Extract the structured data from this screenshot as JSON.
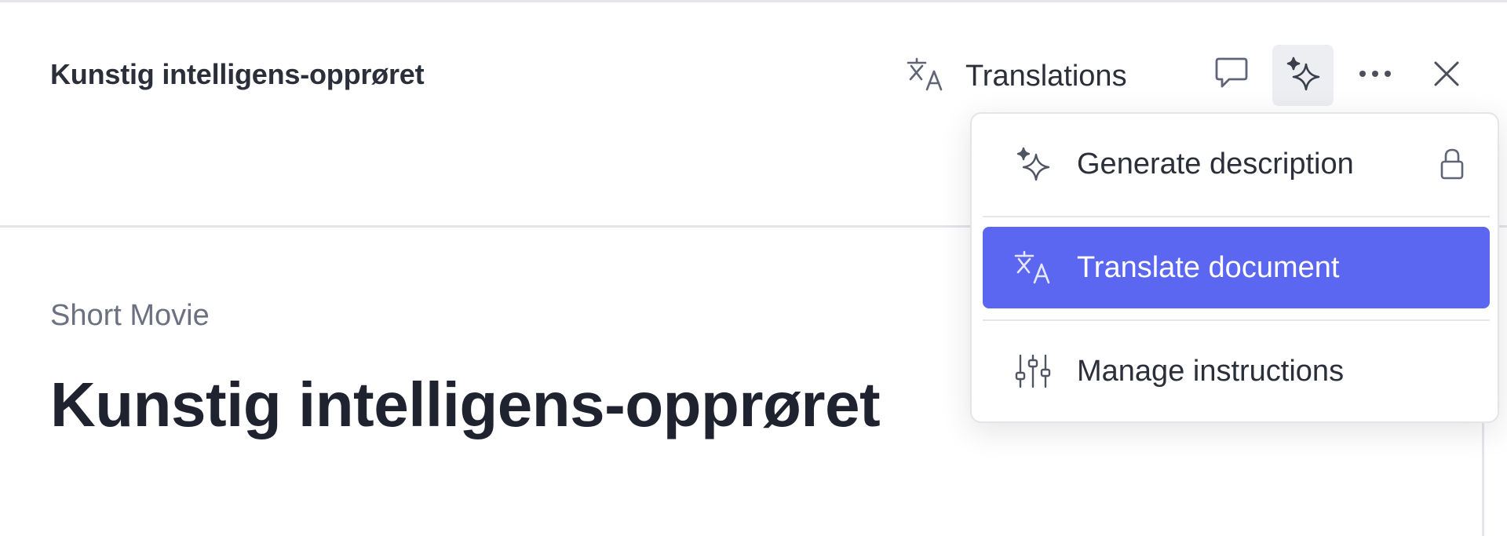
{
  "header": {
    "title": "Kunstig intelligens-opprøret",
    "translations_label": "Translations",
    "icons": {
      "translate": "translate-icon",
      "comment": "comment-icon",
      "ai": "sparkles-icon",
      "more": "more-horizontal-icon",
      "close": "close-icon"
    }
  },
  "document": {
    "type": "Short Movie",
    "title": "Kunstig intelligens-opprøret"
  },
  "ai_menu": {
    "items": [
      {
        "label": "Generate description",
        "icon": "sparkles-icon",
        "trailing_icon": "lock-icon"
      },
      {
        "label": "Translate document",
        "icon": "translate-icon",
        "selected": true
      },
      {
        "label": "Manage instructions",
        "icon": "sliders-icon"
      }
    ]
  },
  "colors": {
    "accent": "#5b67f1",
    "text": "#2b2f3a",
    "muted": "#6b7180",
    "border": "#e4e6ea"
  }
}
